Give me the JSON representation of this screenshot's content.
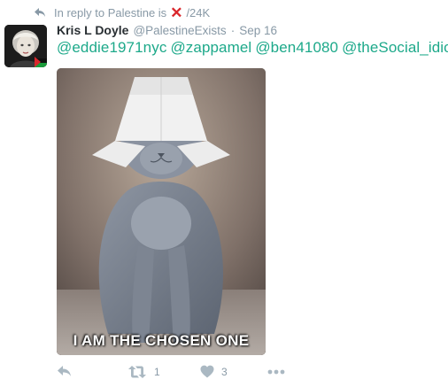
{
  "reply_context": {
    "prefix": "In reply to Palestine is",
    "cross_symbol": "✕",
    "suffix": "/24K",
    "icon": "reply-arrow-icon"
  },
  "tweet": {
    "fullname": "Kris L Doyle",
    "username": "@PalestineExists",
    "separator": "·",
    "time": "Sep 16",
    "mentions": [
      "@eddie1971nyc",
      "@zappamel",
      "@ben41080",
      "@theSocial_idiot"
    ],
    "media_caption": "I AM THE CHOSEN ONE"
  },
  "actions": {
    "reply_icon": "reply-icon",
    "retweet_icon": "retweet-icon",
    "retweet_count": "1",
    "like_icon": "heart-icon",
    "like_count": "3",
    "more_icon": "more-dots-icon"
  },
  "colors": {
    "link": "#1da98a",
    "muted": "#8899a6",
    "icon_gray": "#aab8c2",
    "cross_red": "#d9262b"
  }
}
